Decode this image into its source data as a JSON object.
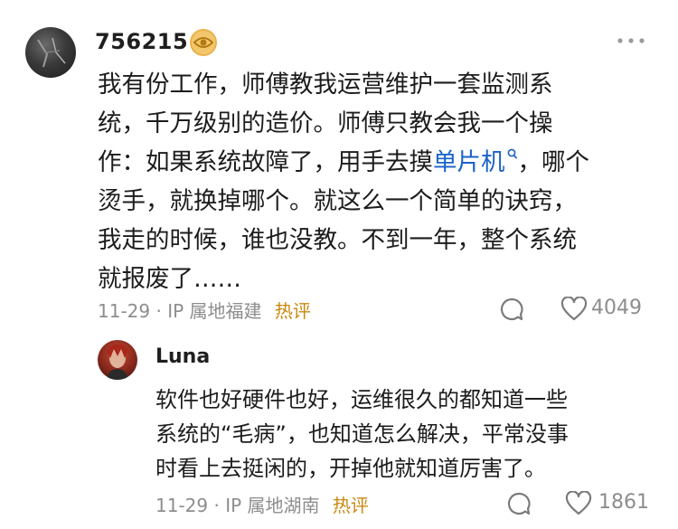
{
  "comment": {
    "username": "756215",
    "badge_icon": "eye-badge-icon",
    "more_icon": "more-dots-icon",
    "text_lines": [
      "我有份工作，师傅教我运营维护一套监测系",
      "统，千万级别的造价。师傅只教会我一个操",
      "作：如果系统故障了，用手去摸",
      "烫手，就换掉哪个。就这么一个简单的诀窍，",
      "我走的时候，谁也没教。不到一年，整个系统",
      "就报废了……"
    ],
    "link_text": "单片机",
    "after_link": "，哪个",
    "date": "11-29",
    "location": "IP 属地福建",
    "hot_label": "热评",
    "likes": "4049"
  },
  "reply": {
    "username": "Luna",
    "text_lines": [
      "软件也好硬件也好，运维很久的都知道一些",
      "系统的“毛病”，也知道怎么解决，平常没事",
      "时看上去挺闲的，开掉他就知道厉害了。"
    ],
    "date": "11-29",
    "location": "IP 属地湖南",
    "hot_label": "热评",
    "likes": "1861"
  },
  "colors": {
    "link": "#1a62c9",
    "hot": "#c9880f",
    "meta": "#8d8d8d"
  }
}
